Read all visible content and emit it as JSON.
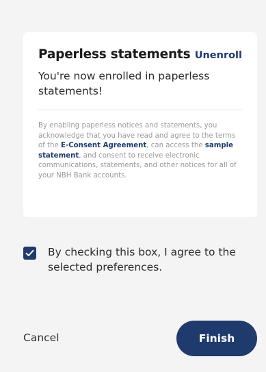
{
  "card": {
    "title": "Paperless statements",
    "unenroll_label": "Unenroll",
    "status_text": "You're now enrolled in paperless statements!",
    "consent": {
      "part1": "By enabling paperless notices and statements, you acknowledge that you have read and agree to the terms of the ",
      "econsent_link": "E-Consent Agreement",
      "part2": ", can access the ",
      "sample_link": "sample statement",
      "part3": ", and consent to receive electronic communications, statements, and other notices for all of your NBH Bank accounts."
    }
  },
  "agreement": {
    "checked": true,
    "label": "By checking this box, I agree to the selected preferences."
  },
  "actions": {
    "cancel_label": "Cancel",
    "finish_label": "Finish"
  },
  "colors": {
    "primary": "#1f3a6d",
    "background": "#f4f4f4",
    "card": "#ffffff"
  }
}
